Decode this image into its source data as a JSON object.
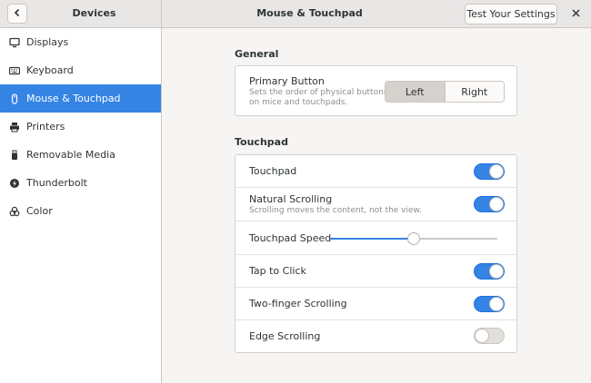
{
  "header": {
    "sidebar_title": "Devices",
    "title": "Mouse & Touchpad",
    "test_button": "Test Your Settings",
    "back_icon": "chevron-left-icon",
    "close_icon": "close-icon"
  },
  "sidebar": {
    "items": [
      {
        "label": "Displays",
        "icon": "display-icon"
      },
      {
        "label": "Keyboard",
        "icon": "keyboard-icon"
      },
      {
        "label": "Mouse & Touchpad",
        "icon": "mouse-icon",
        "active": true
      },
      {
        "label": "Printers",
        "icon": "printer-icon"
      },
      {
        "label": "Removable Media",
        "icon": "usb-icon"
      },
      {
        "label": "Thunderbolt",
        "icon": "thunderbolt-icon"
      },
      {
        "label": "Color",
        "icon": "color-icon"
      }
    ]
  },
  "general": {
    "title": "General",
    "primary_button": {
      "label": "Primary Button",
      "description_line1": "Sets the order of physical buttons",
      "description_line2": "on mice and touchpads.",
      "options": [
        "Left",
        "Right"
      ],
      "selected": "Left"
    }
  },
  "touchpad": {
    "title": "Touchpad",
    "touchpad": {
      "label": "Touchpad",
      "enabled": true
    },
    "natural_scrolling": {
      "label": "Natural Scrolling",
      "description": "Scrolling moves the content, not the view.",
      "enabled": true
    },
    "speed": {
      "label": "Touchpad Speed",
      "value_fraction": 0.5
    },
    "tap_to_click": {
      "label": "Tap to Click",
      "enabled": true
    },
    "two_finger": {
      "label": "Two-finger Scrolling",
      "enabled": true
    },
    "edge": {
      "label": "Edge Scrolling",
      "enabled": false
    }
  },
  "colors": {
    "accent": "#3584e4",
    "sidebar_active": "#3584e4"
  }
}
